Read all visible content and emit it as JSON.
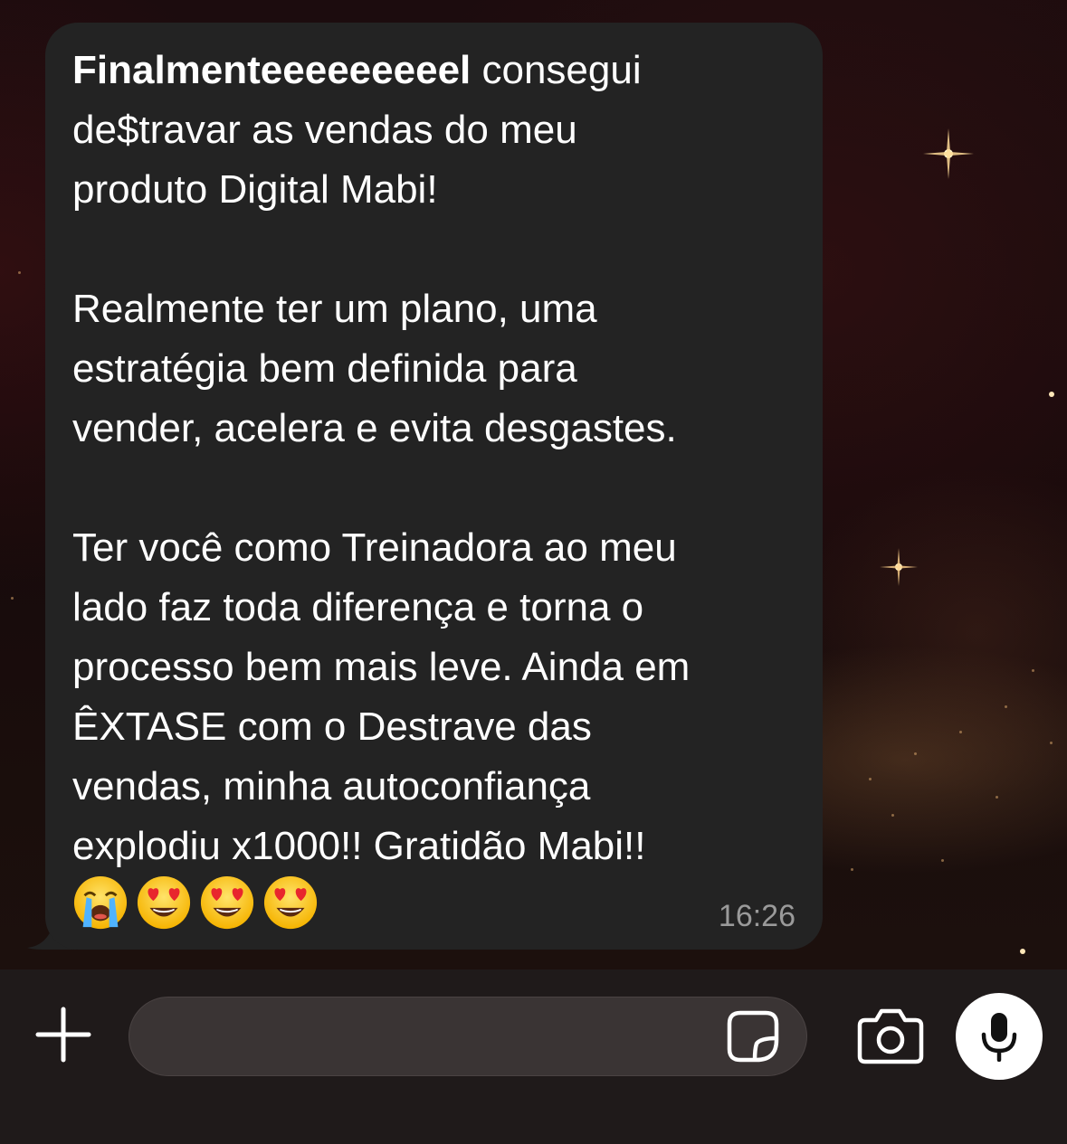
{
  "conversation": {
    "message": {
      "bold_lead": "Finalmenteeeeeeeeel",
      "text_after_lead": " consegui\nde$travar as vendas do meu\nproduto Digital Mabi!\n\nRealmente ter um plano, uma\nestratégia bem definida para\nvender, acelera e evita desgastes.\n\nTer você como Treinadora ao meu\nlado faz toda diferença e torna o\nprocesso bem mais leve. Ainda em\nÊXTASE com o Destrave das\nvendas, minha autoconfiança\nexplodiu x1000!! Gratidão Mabi!!",
      "emojis": [
        "crying-face-emoji",
        "heart-eyes-emoji",
        "heart-eyes-emoji",
        "heart-eyes-emoji"
      ],
      "time": "16:26"
    }
  },
  "composer": {
    "text_value": "",
    "icons": {
      "add": "plus-icon",
      "sticker": "sticker-icon",
      "camera": "camera-icon",
      "mic": "microphone-icon"
    }
  },
  "colors": {
    "bubble": "#232323",
    "message_text": "#ffffff",
    "timestamp": "#9a9a9a",
    "input_bar": "#1f1a1a",
    "mic_button": "#ffffff"
  }
}
